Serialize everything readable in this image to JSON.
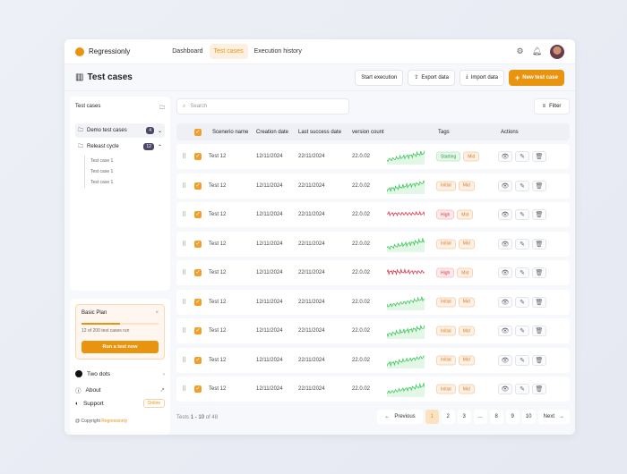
{
  "app": {
    "name": "Regressionly",
    "nav": [
      "Dashboard",
      "Test cases",
      "Execution history"
    ],
    "active_nav": 1
  },
  "page": {
    "title": "Test cases",
    "buttons": {
      "start": "Start execution",
      "export": "Export data",
      "import": "Import data",
      "new": "New test case"
    }
  },
  "sidebar": {
    "heading": "Test cases",
    "folders": [
      {
        "label": "Demo test cases",
        "count": "4"
      },
      {
        "label": "Releast cycle",
        "count": "12"
      }
    ],
    "subitems": [
      "Test case 1",
      "Test case 1",
      "Test case 1"
    ],
    "plan": {
      "title": "Basic Plan",
      "progress": 0.5,
      "text": "12 of 200 test cases run",
      "cta": "Run a test now"
    },
    "workspace": "Two dots",
    "about": "About",
    "support": "Support",
    "status": "Online",
    "copyright": "@ Copyright",
    "copyright_brand": "Regressionly"
  },
  "search": {
    "placeholder": "Search"
  },
  "filter_label": "Filter",
  "table": {
    "columns": [
      "Scenerio name",
      "Creation date",
      "Last success date",
      "version count",
      "Tags",
      "Actions"
    ],
    "rows": [
      {
        "name": "Test 12",
        "created": "12/11/2024",
        "success": "22/11/2024",
        "version": "22.0.02",
        "trend": "up",
        "tags": [
          "Starting",
          "Mid"
        ]
      },
      {
        "name": "Test 12",
        "created": "12/11/2024",
        "success": "22/11/2024",
        "version": "22.0.02",
        "trend": "up",
        "tags": [
          "Initial",
          "Mid"
        ]
      },
      {
        "name": "Test 12",
        "created": "12/11/2024",
        "success": "22/11/2024",
        "version": "22.0.02",
        "trend": "down",
        "tags": [
          "High",
          "Mid"
        ]
      },
      {
        "name": "Test 12",
        "created": "12/11/2024",
        "success": "22/11/2024",
        "version": "22.0.02",
        "trend": "up",
        "tags": [
          "Initial",
          "Mid"
        ]
      },
      {
        "name": "Test 12",
        "created": "12/11/2024",
        "success": "22/11/2024",
        "version": "22.0.02",
        "trend": "down",
        "tags": [
          "High",
          "Mid"
        ]
      },
      {
        "name": "Test 12",
        "created": "12/11/2024",
        "success": "22/11/2024",
        "version": "22.0.02",
        "trend": "up",
        "tags": [
          "Initial",
          "Mid"
        ]
      },
      {
        "name": "Test 12",
        "created": "12/11/2024",
        "success": "22/11/2024",
        "version": "22.0.02",
        "trend": "up",
        "tags": [
          "Initial",
          "Mid"
        ]
      },
      {
        "name": "Test 12",
        "created": "12/11/2024",
        "success": "22/11/2024",
        "version": "22.0.02",
        "trend": "up",
        "tags": [
          "Initial",
          "Mid"
        ]
      },
      {
        "name": "Test 12",
        "created": "12/11/2024",
        "success": "22/11/2024",
        "version": "22.0.02",
        "trend": "up",
        "tags": [
          "Initial",
          "Mid"
        ]
      }
    ]
  },
  "pagination": {
    "summary_prefix": "Tests",
    "range": "1 - 10",
    "of": "of 48",
    "prev": "Previous",
    "next": "Next",
    "pages": [
      "1",
      "2",
      "3",
      "...",
      "8",
      "9",
      "10"
    ],
    "current": "1"
  },
  "colors": {
    "accent": "#e8940f",
    "up": "#3cc85a",
    "down": "#e0344a"
  }
}
